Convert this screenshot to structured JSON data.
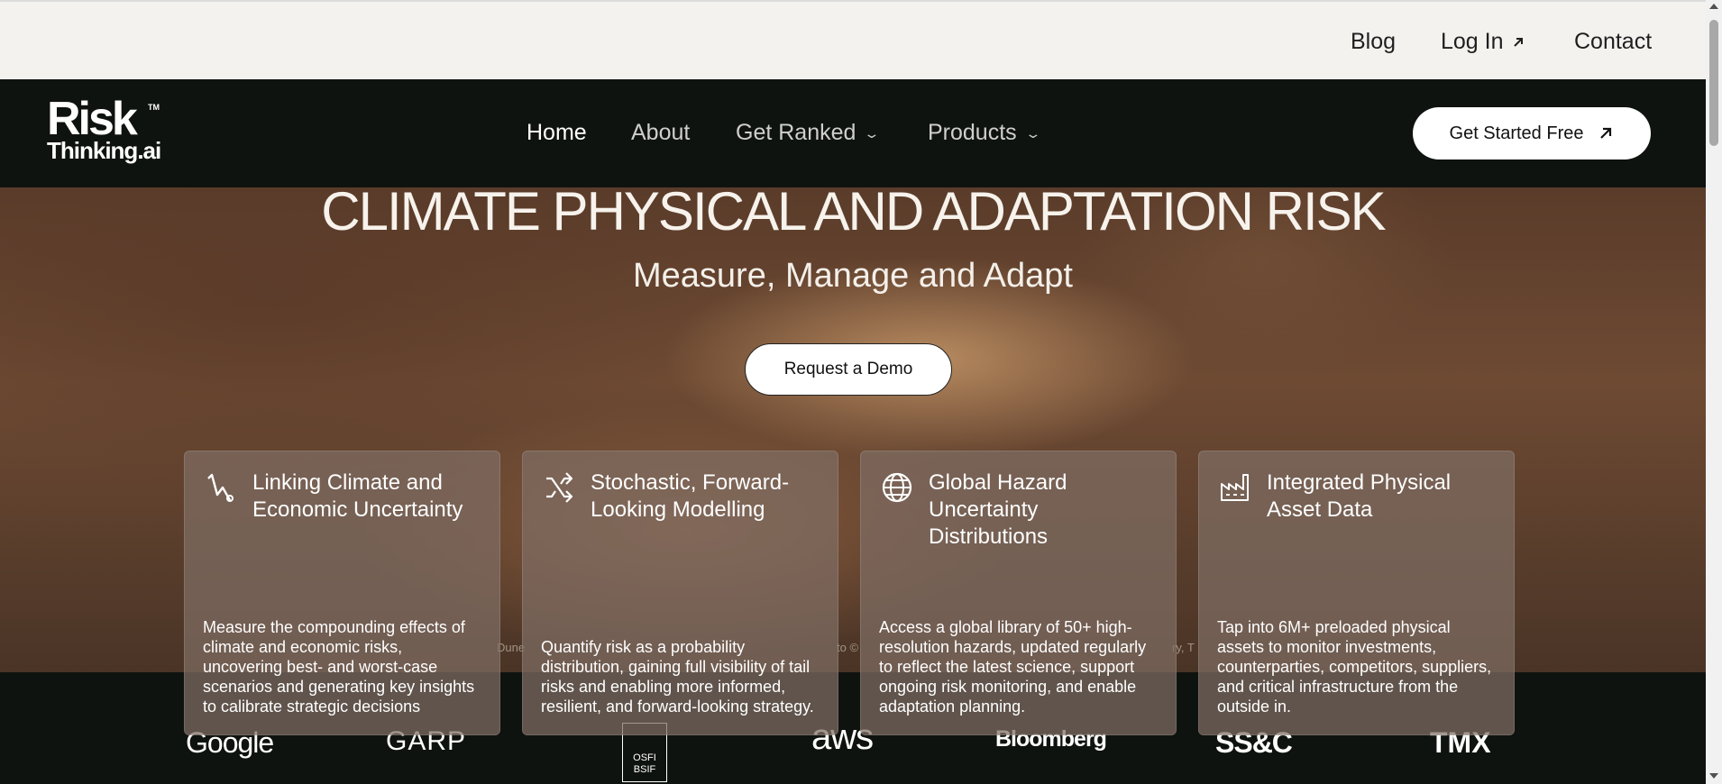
{
  "topbar": {
    "blog": "Blog",
    "login": "Log In",
    "contact": "Contact"
  },
  "brand": {
    "line1": "Risk",
    "tm": "TM",
    "line2": "Thinking.ai"
  },
  "nav": {
    "home": "Home",
    "about": "About",
    "get_ranked": "Get Ranked",
    "products": "Products",
    "cta": "Get Started Free"
  },
  "hero": {
    "title": "CLIMATE PHYSICAL AND ADAPTATION RISK",
    "subtitle": "Measure, Manage and Adapt",
    "demo_button": "Request a Demo",
    "credit_a": "Dune",
    "credit_b": "to ©",
    "credit_c": "ry, T"
  },
  "cards": [
    {
      "title": "Linking Climate and Economic Uncertainty",
      "desc": "Measure the compounding effects of climate and economic risks, uncovering best- and worst-case scenarios and generating key insights to calibrate strategic decisions",
      "icon": "activity-icon"
    },
    {
      "title": "Stochastic, Forward-Looking Modelling",
      "desc": "Quantify risk as a probability distribution, gaining full visibility of tail risks and enabling more informed, resilient, and forward-looking strategy.",
      "icon": "shuffle-icon"
    },
    {
      "title": "Global Hazard Uncertainty Distributions",
      "desc": "Access a global library of 50+ high-resolution hazards, updated regularly to reflect the latest science, support ongoing risk monitoring, and enable adaptation planning.",
      "icon": "globe-icon"
    },
    {
      "title": "Integrated Physical Asset Data",
      "desc": "Tap into 6M+ preloaded physical assets to monitor investments, counterparties, competitors, suppliers, and critical infrastructure from the outside in.",
      "icon": "factory-icon"
    }
  ],
  "partners": {
    "google": "Google",
    "garp": "GARP",
    "osfi_1": "OSFI",
    "osfi_2": "BSIF",
    "aws": "aws",
    "bloomberg": "Bloomberg",
    "ssc": "SS&C",
    "tmx": "TMX"
  }
}
